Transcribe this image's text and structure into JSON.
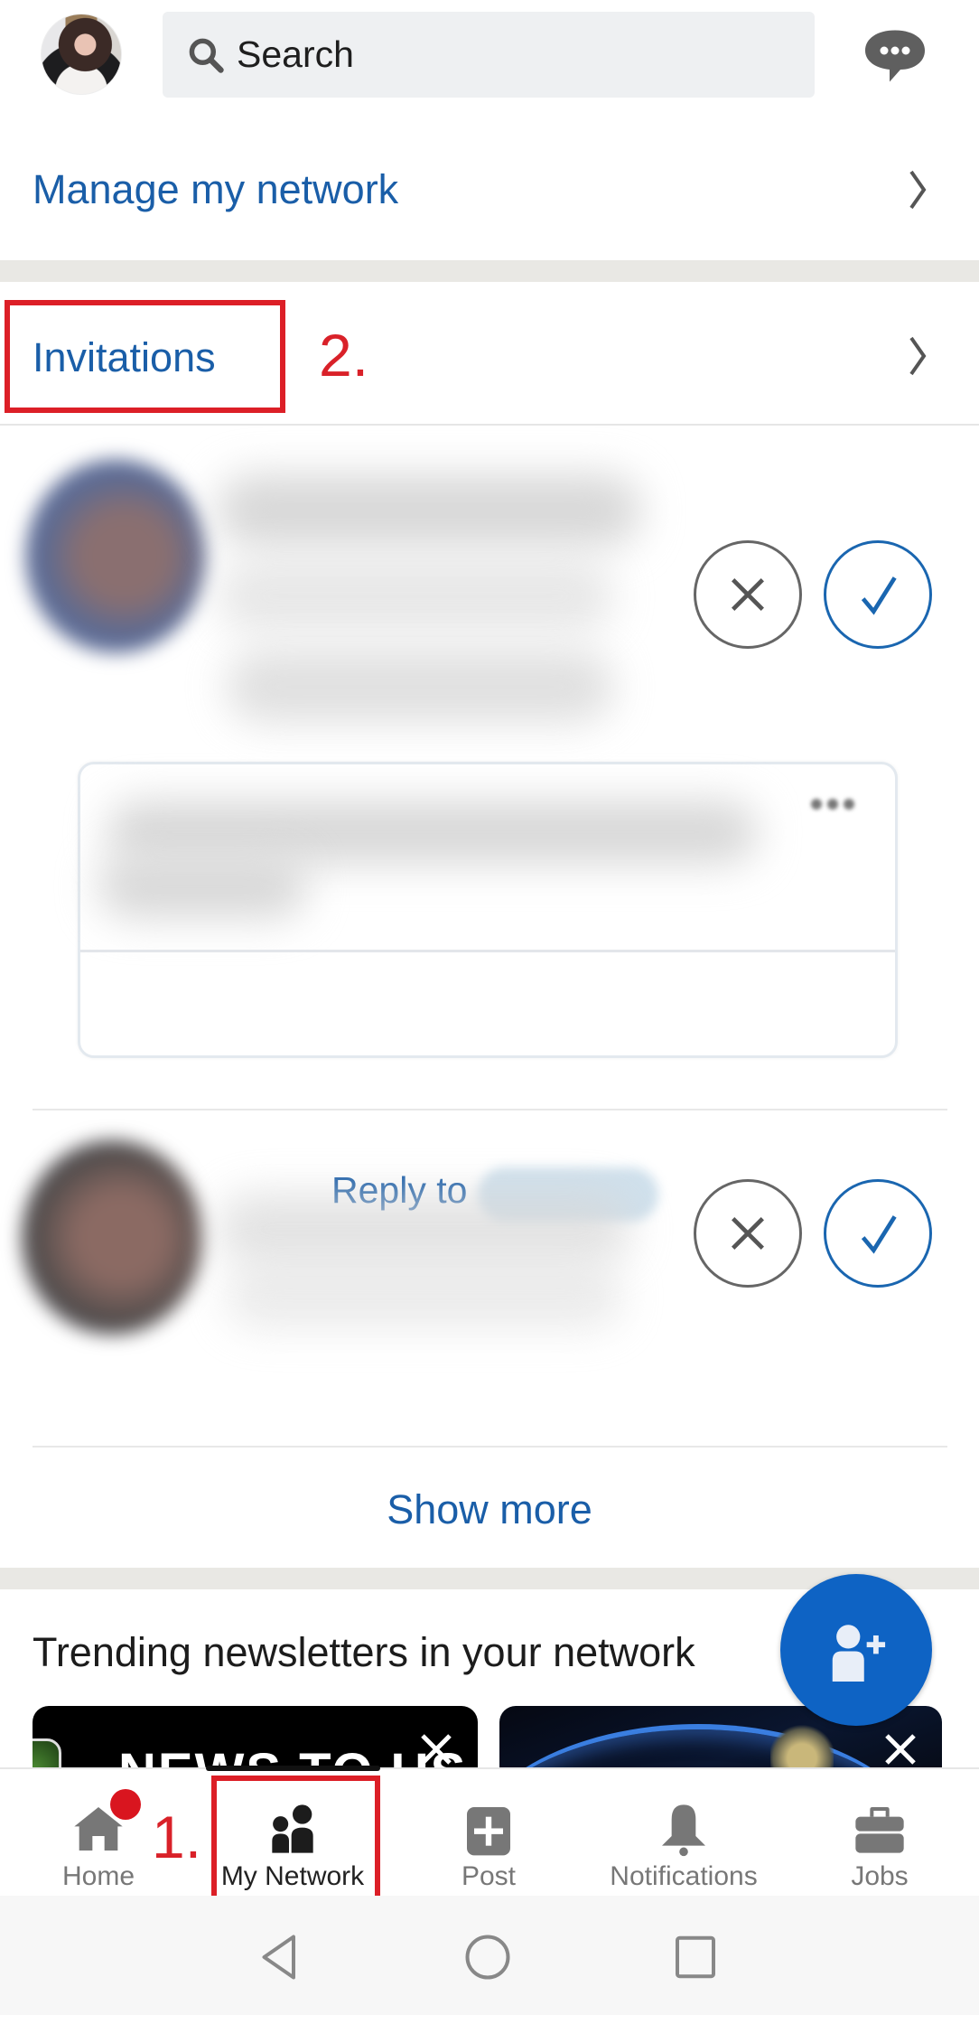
{
  "top_bar": {
    "avatar_alt": "Profile photo",
    "search": {
      "placeholder": "Search",
      "value": ""
    },
    "messaging_icon": "messaging-icon"
  },
  "sections": {
    "manage": {
      "label": "Manage my network"
    },
    "invitations": {
      "label": "Invitations"
    },
    "show_more": "Show more",
    "trending": {
      "title": "Trending newsletters in your network"
    }
  },
  "invitations": [
    {
      "name": "",
      "has_message": true,
      "message": {
        "reply_label": "Reply to"
      },
      "ignore_label": "Ignore",
      "accept_label": "Accept"
    },
    {
      "name": "",
      "has_message": false,
      "ignore_label": "Ignore",
      "accept_label": "Accept"
    }
  ],
  "newsletters": [
    {
      "visible_text": "NEWS TO US",
      "close_icon": "close-icon"
    },
    {
      "visible_text": "",
      "close_icon": "close-icon"
    }
  ],
  "fab": {
    "icon": "add-person-icon"
  },
  "annotations": {
    "step1": "1.",
    "step2": "2.",
    "color": "#dc1f27"
  },
  "bottom_nav": {
    "items": [
      {
        "label": "Home",
        "icon": "home-icon",
        "active": false,
        "badge": true
      },
      {
        "label": "My Network",
        "icon": "my-network-icon",
        "active": true,
        "badge": false
      },
      {
        "label": "Post",
        "icon": "post-icon",
        "active": false,
        "badge": false
      },
      {
        "label": "Notifications",
        "icon": "bell-icon",
        "active": false,
        "badge": false
      },
      {
        "label": "Jobs",
        "icon": "briefcase-icon",
        "active": false,
        "badge": false
      }
    ]
  },
  "system_nav": [
    "back",
    "home",
    "recents"
  ],
  "colors": {
    "brand_blue": "#0e63c4",
    "link_blue": "#1a5ea8",
    "badge_red": "#d9151f",
    "icon_gray": "#777777"
  }
}
